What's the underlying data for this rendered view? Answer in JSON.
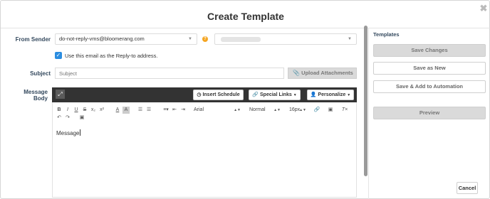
{
  "dialog": {
    "title": "Create Template",
    "close_icon": "close-icon"
  },
  "form": {
    "from_sender_label": "From Sender",
    "from_sender_value": "do-not-reply-vms@bloomerang.com",
    "reply_to_checkbox_checked": true,
    "reply_to_label": "Use this email as the Reply-to address.",
    "subject_label": "Subject",
    "subject_placeholder": "Subject",
    "upload_label": "Upload Attachments",
    "message_body_label": "Message Body"
  },
  "editor": {
    "insert_schedule_label": "Insert Schedule",
    "special_links_label": "Special Links",
    "personalize_label": "Personalize",
    "font_family": "Arial",
    "format": "Normal",
    "font_size": "16px",
    "message_text": "Message"
  },
  "templates_panel": {
    "title": "Templates",
    "save_changes": "Save Changes",
    "save_as_new": "Save as New",
    "save_add_automation": "Save & Add to Automation",
    "preview": "Preview"
  },
  "footer": {
    "cancel": "Cancel"
  }
}
